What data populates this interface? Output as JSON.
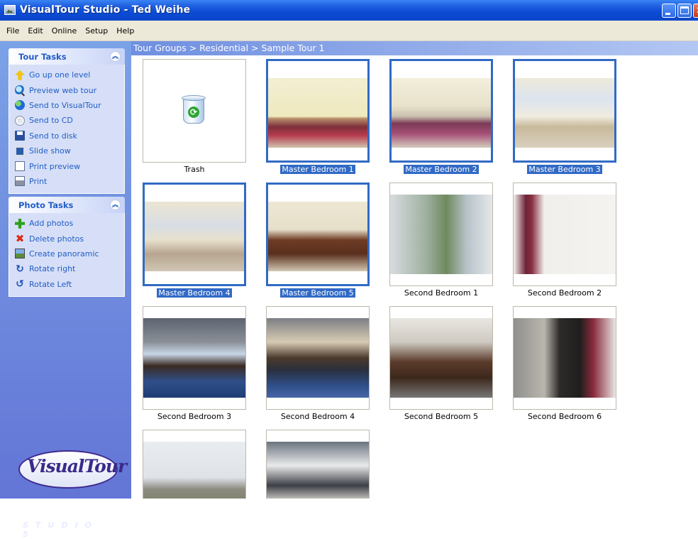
{
  "window": {
    "title": "VisualTour Studio - Ted Weihe"
  },
  "menu": [
    "File",
    "Edit",
    "Online",
    "Setup",
    "Help"
  ],
  "tour_tasks": {
    "header": "Tour Tasks",
    "items": [
      {
        "label": "Go up one level",
        "icon": "up-arrow-icon"
      },
      {
        "label": "Preview web tour",
        "icon": "magnifier-icon"
      },
      {
        "label": "Send to VisualTour",
        "icon": "globe-icon"
      },
      {
        "label": "Send to CD",
        "icon": "cd-icon"
      },
      {
        "label": "Send to disk",
        "icon": "floppy-disk-icon"
      },
      {
        "label": "Slide show",
        "icon": "slideshow-icon"
      },
      {
        "label": "Print preview",
        "icon": "print-preview-icon"
      },
      {
        "label": "Print",
        "icon": "printer-icon"
      }
    ]
  },
  "photo_tasks": {
    "header": "Photo Tasks",
    "items": [
      {
        "label": "Add photos",
        "icon": "plus-icon"
      },
      {
        "label": "Delete photos",
        "icon": "red-x-icon"
      },
      {
        "label": "Create panoramic",
        "icon": "panorama-icon"
      },
      {
        "label": "Rotate right",
        "icon": "rotate-right-icon"
      },
      {
        "label": "Rotate Left",
        "icon": "rotate-left-icon"
      }
    ]
  },
  "logo": {
    "text": "VisualTour",
    "subtitle": "STUDIO 5"
  },
  "breadcrumb": "Tour Groups > Residential > Sample Tour 1",
  "thumbnails": [
    {
      "caption": "Trash",
      "selected": false
    },
    {
      "caption": "Master Bedroom 1",
      "selected": true
    },
    {
      "caption": "Master Bedroom 2",
      "selected": true
    },
    {
      "caption": "Master Bedroom 3",
      "selected": true
    },
    {
      "caption": "Master Bedroom 4",
      "selected": true
    },
    {
      "caption": "Master Bedroom 5",
      "selected": true
    },
    {
      "caption": "Second Bedroom 1",
      "selected": false
    },
    {
      "caption": "Second Bedroom 2",
      "selected": false
    },
    {
      "caption": "Second Bedroom 3",
      "selected": false
    },
    {
      "caption": "Second Bedroom 4",
      "selected": false
    },
    {
      "caption": "Second Bedroom 5",
      "selected": false
    },
    {
      "caption": "Second Bedroom 6",
      "selected": false
    },
    {
      "caption": "",
      "selected": false
    },
    {
      "caption": "",
      "selected": false
    }
  ],
  "colors": {
    "selection": "#316ac5",
    "task_text": "#215dc6",
    "pane_top": "#7ba2e7",
    "pane_bottom": "#6375d6"
  }
}
